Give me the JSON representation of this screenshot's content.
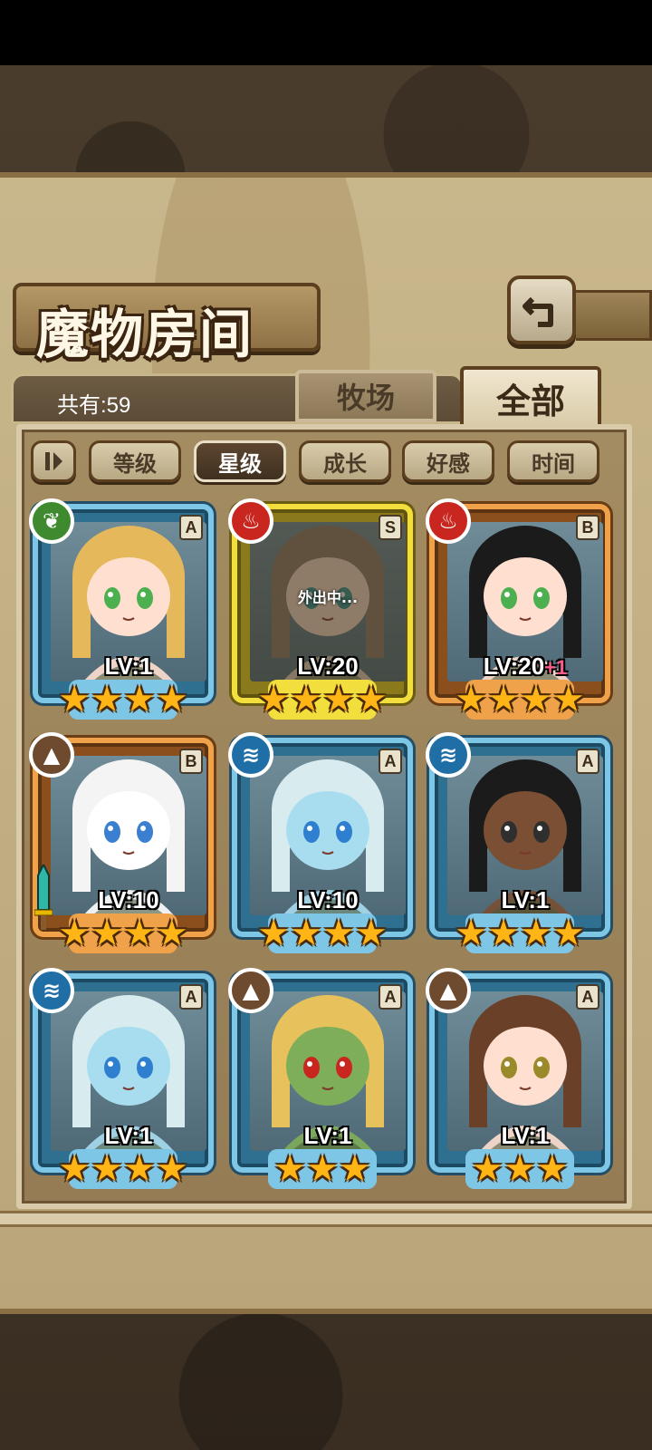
{
  "header": {
    "title": "魔物房间",
    "back_icon": "back-arrow-icon"
  },
  "count": {
    "text": "共有:59"
  },
  "tabs": [
    {
      "label": "牧场",
      "active": false
    },
    {
      "label": "全部",
      "active": true
    }
  ],
  "sort": {
    "toggle_icon": "sort-direction-icon",
    "options": [
      {
        "label": "等级",
        "active": false
      },
      {
        "label": "星级",
        "active": true
      },
      {
        "label": "成长",
        "active": false
      },
      {
        "label": "好感",
        "active": false
      },
      {
        "label": "时间",
        "active": false
      }
    ]
  },
  "monsters": [
    {
      "element": "grass",
      "rank": "A",
      "level": "LV:1",
      "bonus": "",
      "stars": 4,
      "frame": "blue",
      "away": false,
      "hair": "#e6b85c",
      "skin": "#ffe0d0",
      "eyes": "#4caf50"
    },
    {
      "element": "fire",
      "rank": "S",
      "level": "LV:20",
      "bonus": "",
      "stars": 4,
      "frame": "gold",
      "away": true,
      "away_text": "外出中...",
      "hair": "#8a7866",
      "skin": "#f2d8c4",
      "eyes": "#2f8f8f"
    },
    {
      "element": "fire",
      "rank": "B",
      "level": "LV:20",
      "bonus": "+1",
      "stars": 4,
      "frame": "orange",
      "away": false,
      "hair": "#1b1b1b",
      "skin": "#ffe0d0",
      "eyes": "#4caf50"
    },
    {
      "element": "earth",
      "rank": "B",
      "level": "LV:10",
      "bonus": "",
      "stars": 4,
      "frame": "orange",
      "away": false,
      "hair": "#f4f4f4",
      "skin": "#ffffff",
      "eyes": "#3b7fd0",
      "has_weapon": true
    },
    {
      "element": "water",
      "rank": "A",
      "level": "LV:10",
      "bonus": "",
      "stars": 4,
      "frame": "blue",
      "away": false,
      "hair": "#d8ecf0",
      "skin": "#a8dcef",
      "eyes": "#2f7fd0"
    },
    {
      "element": "water",
      "rank": "A",
      "level": "LV:1",
      "bonus": "",
      "stars": 4,
      "frame": "blue",
      "away": false,
      "hair": "#1b1b1b",
      "skin": "#7a4f33",
      "eyes": "#2f2f2f"
    },
    {
      "element": "water",
      "rank": "A",
      "level": "LV:1",
      "bonus": "",
      "stars": 4,
      "frame": "blue",
      "away": false,
      "hair": "#d8ecf0",
      "skin": "#a8dcef",
      "eyes": "#2f7fd0"
    },
    {
      "element": "earth",
      "rank": "A",
      "level": "LV:1",
      "bonus": "",
      "stars": 3,
      "frame": "blue",
      "away": false,
      "hair": "#e6c15c",
      "skin": "#7fae5a",
      "eyes": "#c8261e"
    },
    {
      "element": "earth",
      "rank": "A",
      "level": "LV:1",
      "bonus": "",
      "stars": 3,
      "frame": "blue",
      "away": false,
      "hair": "#6a4028",
      "skin": "#ffe0d0",
      "eyes": "#9a8a2a"
    }
  ],
  "colors": {
    "frame_blue": "#7ec6e6",
    "frame_gold": "#f2df3d",
    "frame_orange": "#f0a24a",
    "star": "#ffb516",
    "bonus": "#ff5a8c"
  }
}
